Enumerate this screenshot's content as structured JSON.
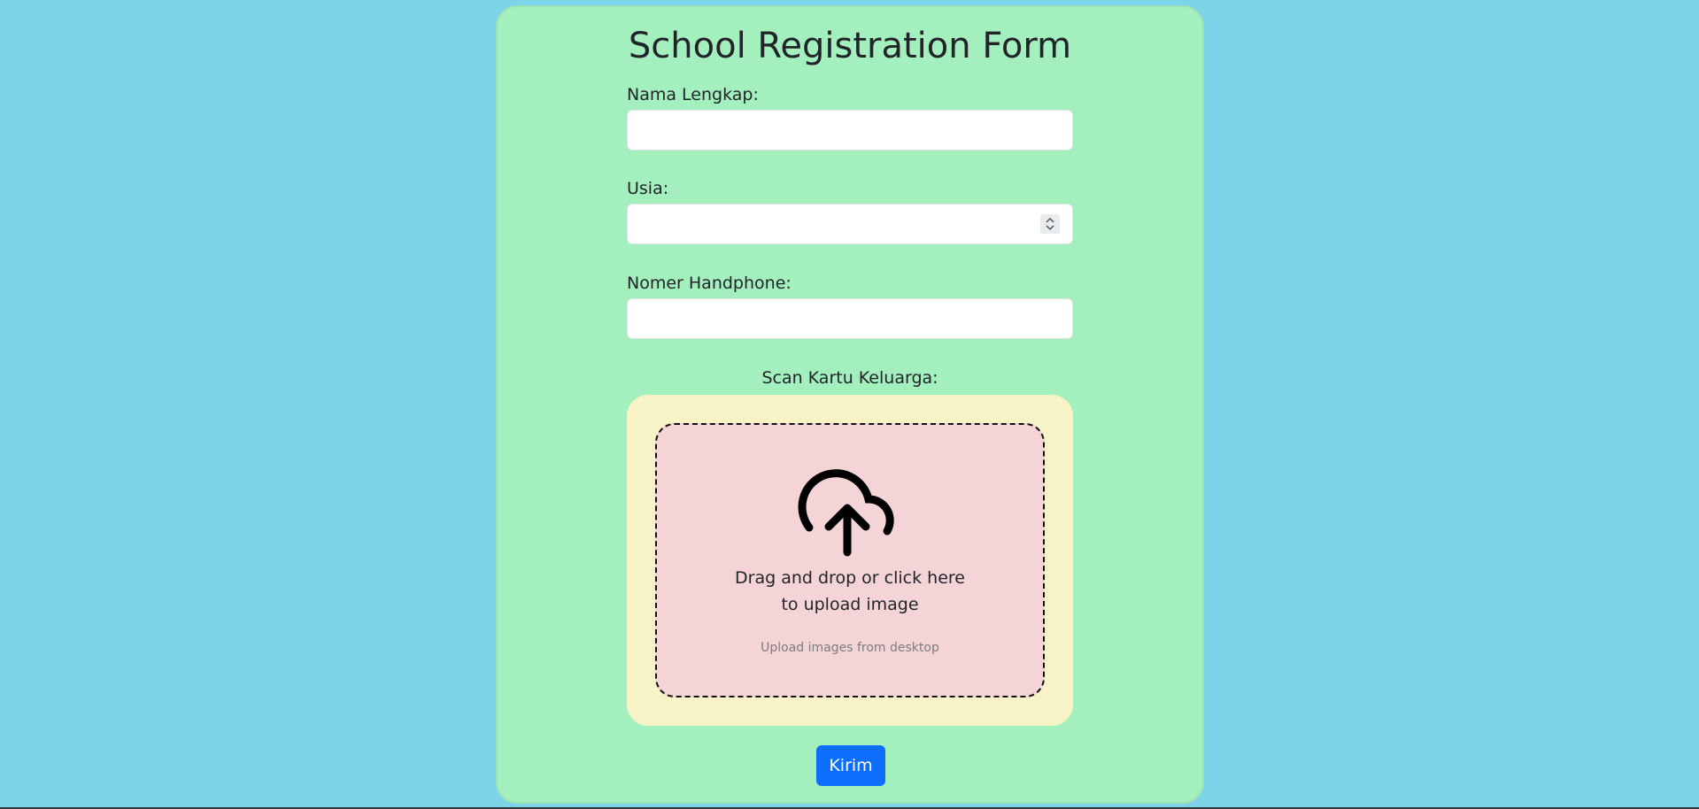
{
  "form": {
    "title": "School Registration Form",
    "fields": [
      {
        "label": "Nama Lengkap:",
        "value": "",
        "type": "text"
      },
      {
        "label": "Usia:",
        "value": "",
        "type": "number"
      },
      {
        "label": "Nomer Handphone:",
        "value": "",
        "type": "text"
      }
    ],
    "upload": {
      "label": "Scan Kartu Keluarga:",
      "line1": "Drag and drop or click here",
      "line2": "to upload image",
      "subtext": "Upload images from desktop",
      "icon": "cloud-upload-icon"
    },
    "submit_label": "Kirim"
  },
  "colors": {
    "page_background": "#7dd3e8",
    "card_background": "#a3efbd",
    "upload_outer": "#f7f3c6",
    "upload_drop": "#f4d4d6",
    "button": "#0d6efd"
  }
}
